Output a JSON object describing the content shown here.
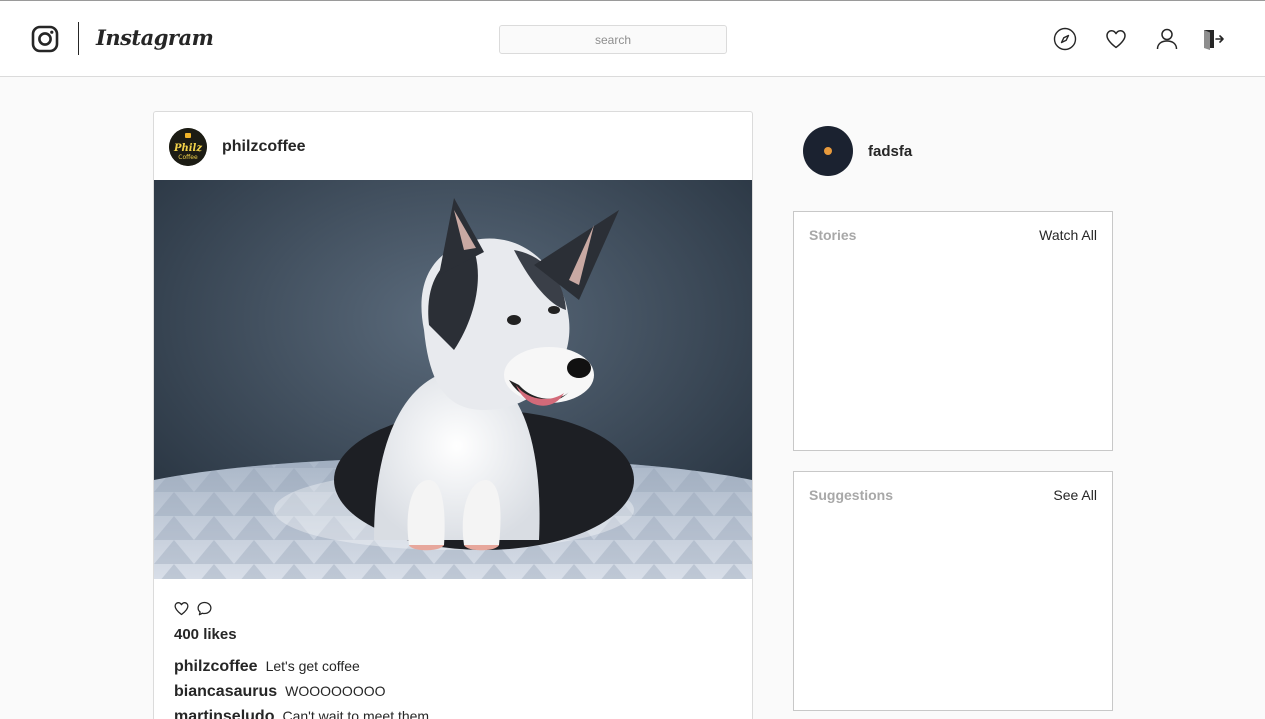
{
  "header": {
    "wordmark": "Instagram",
    "search_placeholder": "search",
    "icons": [
      "instagram-logo-icon",
      "explore-compass-icon",
      "activity-heart-icon",
      "profile-person-icon",
      "logout-door-icon"
    ]
  },
  "post": {
    "username": "philzcoffee",
    "avatar_text": "Philz Coffee",
    "likes": "400 likes",
    "comments": [
      {
        "user": "philzcoffee",
        "text": "Let's get coffee"
      },
      {
        "user": "biancasaurus",
        "text": "WOOOOOOOO"
      },
      {
        "user": "martinseludo",
        "text": "Can't wait to meet them"
      }
    ]
  },
  "sidebar": {
    "profile_name": "fadsfa",
    "stories": {
      "title": "Stories",
      "link": "Watch All"
    },
    "suggestions": {
      "title": "Suggestions",
      "link": "See All"
    }
  },
  "colors": {
    "border": "#dbdbdb",
    "text": "#262626",
    "muted": "#a8a8a8",
    "accent_dot": "#e89a3c"
  }
}
